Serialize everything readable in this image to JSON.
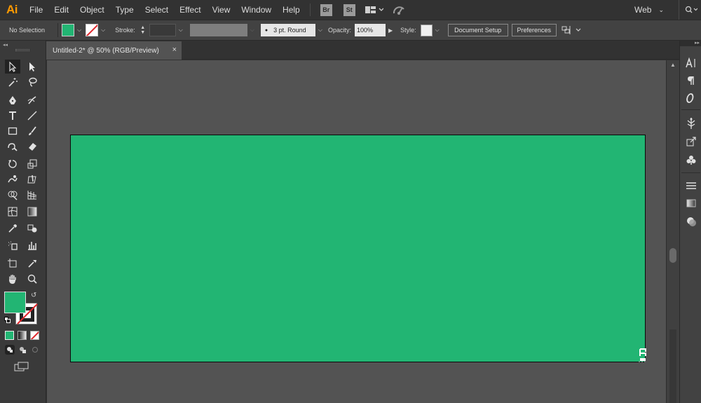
{
  "app": {
    "logo": "Ai",
    "brand_color": "#ff9a00"
  },
  "menu": {
    "items": [
      "File",
      "Edit",
      "Object",
      "Type",
      "Select",
      "Effect",
      "View",
      "Window",
      "Help"
    ],
    "bridge_label": "Br",
    "stock_label": "St",
    "workspace": "Web"
  },
  "control_bar": {
    "selection_status": "No Selection",
    "fill_color": "#22b573",
    "stroke_label": "Stroke:",
    "brush_profile": "3 pt. Round",
    "opacity_label": "Opacity:",
    "opacity_value": "100%",
    "style_label": "Style:",
    "document_setup": "Document Setup",
    "preferences": "Preferences"
  },
  "document": {
    "tab_title": "Untitled-2* @ 50% (RGB/Preview)",
    "close_glyph": "×",
    "artboard_color": "#22b573"
  },
  "toolbar": {
    "tools": [
      "selection-tool",
      "direct-selection-tool",
      "magic-wand-tool",
      "lasso-tool",
      "pen-tool",
      "curvature-tool",
      "type-tool",
      "line-segment-tool",
      "rectangle-tool",
      "paintbrush-tool",
      "shaper-tool",
      "eraser-tool",
      "rotate-tool",
      "scale-tool",
      "warp-tool",
      "free-transform-tool",
      "shape-builder-tool",
      "perspective-grid-tool",
      "mesh-tool",
      "gradient-tool",
      "eyedropper-tool",
      "blend-tool",
      "symbol-sprayer-tool",
      "column-graph-tool",
      "artboard-tool",
      "slice-tool",
      "hand-tool",
      "zoom-tool"
    ],
    "fill_swatch": "#22b573",
    "stroke_swatch": "none"
  },
  "right_dock": {
    "icons": [
      "character-icon",
      "paragraph-icon",
      "opentype-icon",
      "symbols-icon",
      "asset-export-icon",
      "libraries-icon",
      "stroke-panel-icon",
      "gradient-panel-icon",
      "transparency-icon"
    ]
  }
}
